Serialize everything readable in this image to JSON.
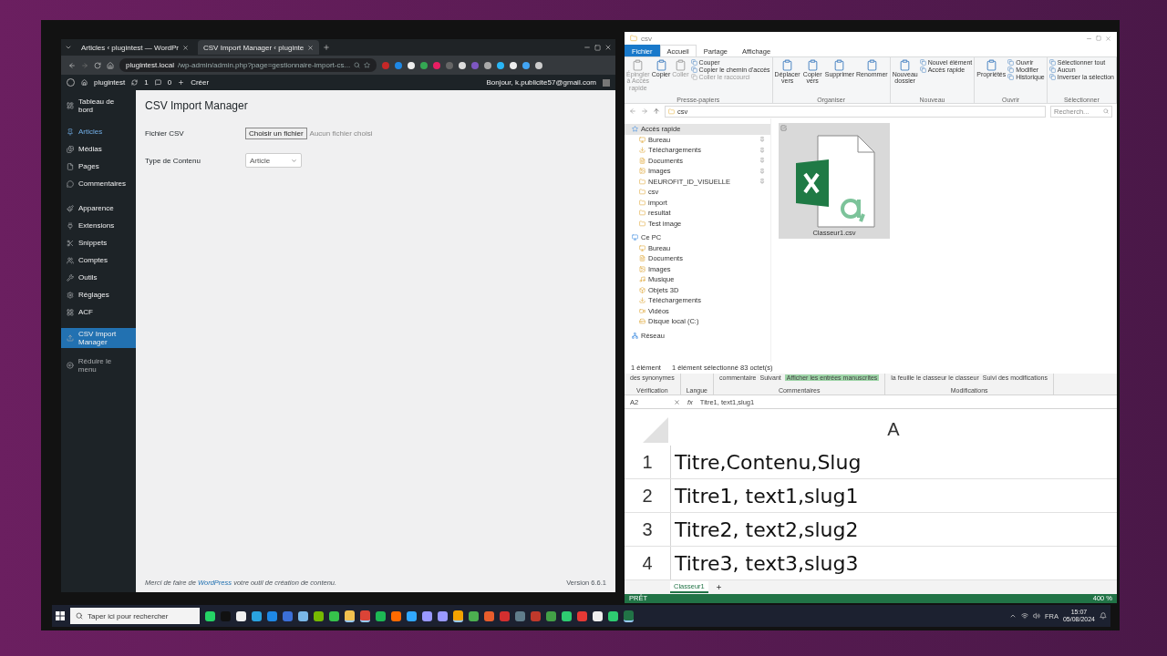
{
  "browser": {
    "tabs": [
      {
        "title": "Articles ‹ plugintest — WordPr",
        "selected": false
      },
      {
        "title": "CSV Import Manager ‹ pluginte",
        "selected": true
      }
    ],
    "url_host": "plugintest.local",
    "url_path": "/wp-admin/admin.php?page=gestionnaire-import-cs...",
    "admin_bar": {
      "site": "plugintest",
      "updates": "1",
      "comments": "0",
      "new": "Créer",
      "greeting": "Bonjour, k.publicite57@gmail.com"
    },
    "sidebar": {
      "groups": [
        [
          {
            "label": "Tableau de bord",
            "selected": false,
            "hovered": false
          }
        ],
        [
          {
            "label": "Articles",
            "selected": false,
            "hovered": true
          },
          {
            "label": "Médias",
            "selected": false,
            "hovered": false
          },
          {
            "label": "Pages",
            "selected": false,
            "hovered": false
          },
          {
            "label": "Commentaires",
            "selected": false,
            "hovered": false
          }
        ],
        [
          {
            "label": "Apparence",
            "selected": false,
            "hovered": false
          },
          {
            "label": "Extensions",
            "selected": false,
            "hovered": false
          },
          {
            "label": "Snippets",
            "selected": false,
            "hovered": false
          },
          {
            "label": "Comptes",
            "selected": false,
            "hovered": false
          },
          {
            "label": "Outils",
            "selected": false,
            "hovered": false
          },
          {
            "label": "Réglages",
            "selected": false,
            "hovered": false
          },
          {
            "label": "ACF",
            "selected": false,
            "hovered": false
          }
        ],
        [
          {
            "label": "CSV Import Manager",
            "selected": true,
            "hovered": false
          }
        ]
      ],
      "collapse": "Réduire le menu"
    },
    "page": {
      "title": "CSV Import Manager",
      "fields": [
        {
          "kind": "file",
          "label": "Fichier CSV",
          "button": "Choisir un fichier",
          "value": "Aucun fichier choisi"
        },
        {
          "kind": "select",
          "label": "Type de Contenu",
          "value": "Article"
        }
      ]
    },
    "footer": {
      "before": "Merci de faire de ",
      "link": "WordPress",
      "after": " votre outil de création de contenu.",
      "version": "Version 6.6.1"
    }
  },
  "explorer": {
    "title": "csv",
    "tabs": [
      {
        "label": "Fichier",
        "kind": "file"
      },
      {
        "label": "Accueil",
        "kind": "tab",
        "selected": true
      },
      {
        "label": "Partage",
        "kind": "tab",
        "selected": false
      },
      {
        "label": "Affichage",
        "kind": "tab",
        "selected": false
      }
    ],
    "ribbon": [
      {
        "name": "Presse-papiers",
        "items": [
          {
            "kind": "large",
            "label": "Épingler à Accès rapide",
            "disabled": true
          },
          {
            "kind": "large",
            "label": "Copier",
            "disabled": false
          },
          {
            "kind": "large",
            "label": "Coller",
            "disabled": true
          },
          {
            "kind": "small",
            "label": "Couper",
            "disabled": false
          },
          {
            "kind": "small",
            "label": "Copier le chemin d'accès",
            "disabled": false
          },
          {
            "kind": "small",
            "label": "Coller le raccourci",
            "disabled": true
          }
        ]
      },
      {
        "name": "Organiser",
        "items": [
          {
            "kind": "large",
            "label": "Déplacer vers",
            "disabled": false
          },
          {
            "kind": "large",
            "label": "Copier vers",
            "disabled": false
          },
          {
            "kind": "large",
            "label": "Supprimer",
            "disabled": false
          },
          {
            "kind": "large",
            "label": "Renommer",
            "disabled": false
          }
        ]
      },
      {
        "name": "Nouveau",
        "items": [
          {
            "kind": "large",
            "label": "Nouveau dossier",
            "disabled": false
          },
          {
            "kind": "small",
            "label": "Nouvel élément",
            "disabled": false
          },
          {
            "kind": "small",
            "label": "Accès rapide",
            "disabled": false
          }
        ]
      },
      {
        "name": "Ouvrir",
        "items": [
          {
            "kind": "large",
            "label": "Propriétés",
            "disabled": false
          },
          {
            "kind": "small",
            "label": "Ouvrir",
            "disabled": false
          },
          {
            "kind": "small",
            "label": "Modifier",
            "disabled": false
          },
          {
            "kind": "small",
            "label": "Historique",
            "disabled": false
          }
        ]
      },
      {
        "name": "Sélectionner",
        "items": [
          {
            "kind": "small",
            "label": "Sélectionner tout",
            "disabled": false
          },
          {
            "kind": "small",
            "label": "Aucun",
            "disabled": false
          },
          {
            "kind": "small",
            "label": "Inverser la sélection",
            "disabled": false
          }
        ]
      }
    ],
    "address": "csv",
    "search": {
      "placeholder": "Recherch..."
    },
    "tree": [
      {
        "label": "Accès rapide",
        "selected": true,
        "children": [
          {
            "label": "Bureau",
            "pinned": true,
            "selected": false
          },
          {
            "label": "Téléchargements",
            "pinned": true,
            "selected": false
          },
          {
            "label": "Documents",
            "pinned": true,
            "selected": false
          },
          {
            "label": "Images",
            "pinned": true,
            "selected": false
          },
          {
            "label": "NEUROFIT_ID_VISUELLE",
            "pinned": true,
            "selected": false
          },
          {
            "label": "csv",
            "pinned": false,
            "selected": false
          },
          {
            "label": "import",
            "pinned": false,
            "selected": false
          },
          {
            "label": "resultat",
            "pinned": false,
            "selected": false
          },
          {
            "label": "Test image",
            "pinned": false,
            "selected": false
          }
        ]
      },
      {
        "label": "Ce PC",
        "selected": false,
        "children": [
          {
            "label": "Bureau",
            "pinned": false,
            "selected": false
          },
          {
            "label": "Documents",
            "pinned": false,
            "selected": false
          },
          {
            "label": "Images",
            "pinned": false,
            "selected": false
          },
          {
            "label": "Musique",
            "pinned": false,
            "selected": false
          },
          {
            "label": "Objets 3D",
            "pinned": false,
            "selected": false
          },
          {
            "label": "Téléchargements",
            "pinned": false,
            "selected": false
          },
          {
            "label": "Vidéos",
            "pinned": false,
            "selected": false
          },
          {
            "label": "Disque local (C:)",
            "pinned": false,
            "selected": false
          }
        ]
      },
      {
        "label": "Réseau",
        "selected": false
      }
    ],
    "files": [
      {
        "name": "Classeur1.csv",
        "selected": true
      }
    ],
    "status": [
      "1 élément",
      "1 élément sélectionné 83 octet(s)"
    ]
  },
  "excel": {
    "ribbon": [
      {
        "name": "Vérification",
        "text": "des synonymes"
      },
      {
        "name": "Langue"
      },
      {
        "name": "Commentaires",
        "text": "commentaire",
        "extra": "Suivant",
        "highlight": "Afficher les entrées manuscrites"
      },
      {
        "name": "Modifications",
        "text": "la feuille le classeur le classeur",
        "extra": "Suivi des modifications"
      }
    ],
    "name_box": "A2",
    "fx_label": "fx",
    "formula": "Titre1, text1,slug1",
    "column": "A",
    "rows": [
      {
        "num": "1",
        "value": "Titre,Contenu,Slug"
      },
      {
        "num": "2",
        "value": "Titre1, text1,slug1"
      },
      {
        "num": "3",
        "value": "Titre2, text2,slug2"
      },
      {
        "num": "4",
        "value": "Titre3, text3,slug3"
      }
    ],
    "sheets": [
      {
        "name": "Classeur1",
        "selected": true
      }
    ],
    "status": "PRÊT",
    "zoom": "400 %"
  },
  "taskbar": {
    "search": {
      "placeholder": "Taper ici pour rechercher"
    },
    "apps": [
      {
        "color": "#25d366",
        "running": false
      },
      {
        "color": "#111111",
        "running": false
      },
      {
        "color": "#f0f0f0",
        "running": false
      },
      {
        "color": "#2aa3e0",
        "running": false
      },
      {
        "color": "#1e88e5",
        "running": false
      },
      {
        "color": "#3b6fd8",
        "running": false
      },
      {
        "color": "#7ab7e8",
        "running": false
      },
      {
        "color": "#76b900",
        "running": false
      },
      {
        "color": "#36c24b",
        "running": false
      },
      {
        "color": "#f2c14e",
        "running": true
      },
      {
        "color": "#db4437",
        "running": true
      },
      {
        "color": "#1db954",
        "running": false
      },
      {
        "color": "#ff6a00",
        "running": false
      },
      {
        "color": "#31a8ff",
        "running": false
      },
      {
        "color": "#9999ff",
        "running": false
      },
      {
        "color": "#9999ff",
        "running": false
      },
      {
        "color": "#f4a300",
        "running": true
      },
      {
        "color": "#4caf50",
        "running": false
      },
      {
        "color": "#e85d2c",
        "running": false
      },
      {
        "color": "#d32f2f",
        "running": false
      },
      {
        "color": "#607d8b",
        "running": false
      },
      {
        "color": "#c0392b",
        "running": false
      },
      {
        "color": "#43a047",
        "running": false
      },
      {
        "color": "#2ecc71",
        "running": false
      },
      {
        "color": "#e53935",
        "running": false
      },
      {
        "color": "#eeeeee",
        "running": false
      },
      {
        "color": "#2ecc71",
        "running": false
      },
      {
        "color": "#217346",
        "running": true
      }
    ],
    "lang": "FRA",
    "time": "15:07",
    "date": "05/08/2024"
  }
}
